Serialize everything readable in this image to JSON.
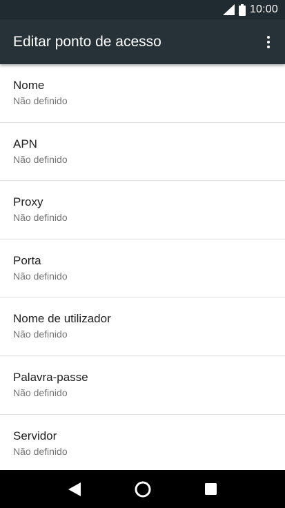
{
  "status_bar": {
    "time": "10:00",
    "icons": [
      "signal-icon",
      "battery-icon"
    ]
  },
  "app_bar": {
    "title": "Editar ponto de acesso",
    "menu_icon": "more-vert-icon"
  },
  "fields": [
    {
      "label": "Nome",
      "value": "Não definido"
    },
    {
      "label": "APN",
      "value": "Não definido"
    },
    {
      "label": "Proxy",
      "value": "Não definido"
    },
    {
      "label": "Porta",
      "value": "Não definido"
    },
    {
      "label": "Nome de utilizador",
      "value": "Não definido"
    },
    {
      "label": "Palavra-passe",
      "value": "Não definido"
    },
    {
      "label": "Servidor",
      "value": "Não definido"
    }
  ],
  "nav_bar": {
    "buttons": [
      "back-icon",
      "home-icon",
      "recents-icon"
    ]
  },
  "colors": {
    "status_bar": "#1f2a31",
    "app_bar": "#263238",
    "nav_bar": "#000000",
    "primary_text": "#212121",
    "secondary_text": "#757575",
    "divider": "#e0e0e0"
  }
}
